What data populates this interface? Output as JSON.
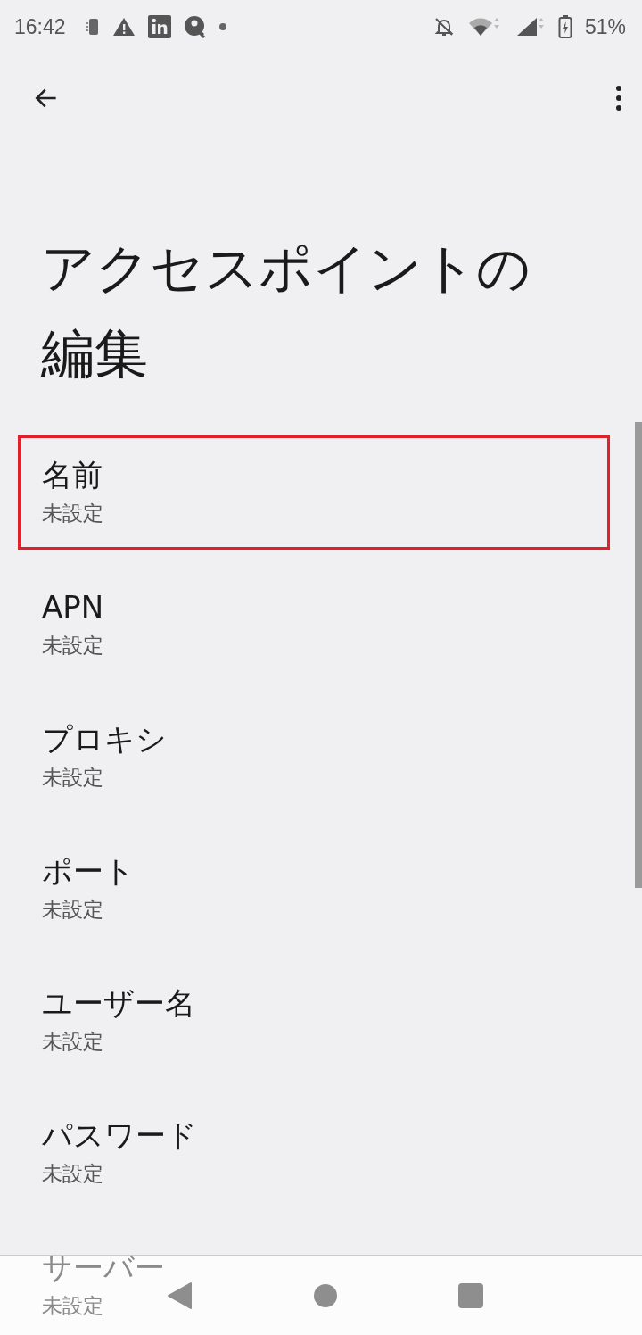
{
  "status_bar": {
    "time": "16:42",
    "battery": "51%"
  },
  "title": "アクセスポイントの編集",
  "items": [
    {
      "label": "名前",
      "value": "未設定",
      "highlighted": true
    },
    {
      "label": "APN",
      "value": "未設定",
      "highlighted": false
    },
    {
      "label": "プロキシ",
      "value": "未設定",
      "highlighted": false
    },
    {
      "label": "ポート",
      "value": "未設定",
      "highlighted": false
    },
    {
      "label": "ユーザー名",
      "value": "未設定",
      "highlighted": false
    },
    {
      "label": "パスワード",
      "value": "未設定",
      "highlighted": false
    },
    {
      "label": "サーバー",
      "value": "未設定",
      "highlighted": false
    }
  ]
}
